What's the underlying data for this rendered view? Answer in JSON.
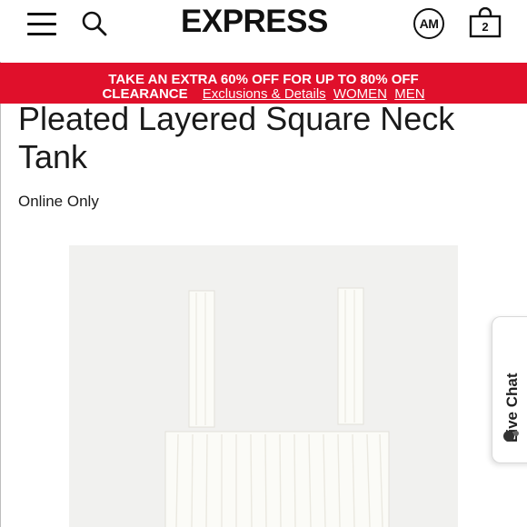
{
  "header": {
    "logo_text": "EXPRESS",
    "account_initials": "AM",
    "bag_count": "2"
  },
  "promo": {
    "line1": "TAKE AN EXTRA 60% OFF FOR UP TO 80% OFF",
    "clearance": "CLEARANCE",
    "exclusions_link": "Exclusions & Details",
    "women_link": "WOMEN",
    "men_link": "MEN",
    "background_color": "#e0102b"
  },
  "product": {
    "title": "Pleated Layered Square Neck Tank",
    "availability": "Online Only"
  },
  "live_chat": {
    "label": "Live Chat"
  },
  "icons": [
    "menu-icon",
    "search-icon",
    "account-icon",
    "shopping-bag-icon",
    "chat-icon"
  ]
}
